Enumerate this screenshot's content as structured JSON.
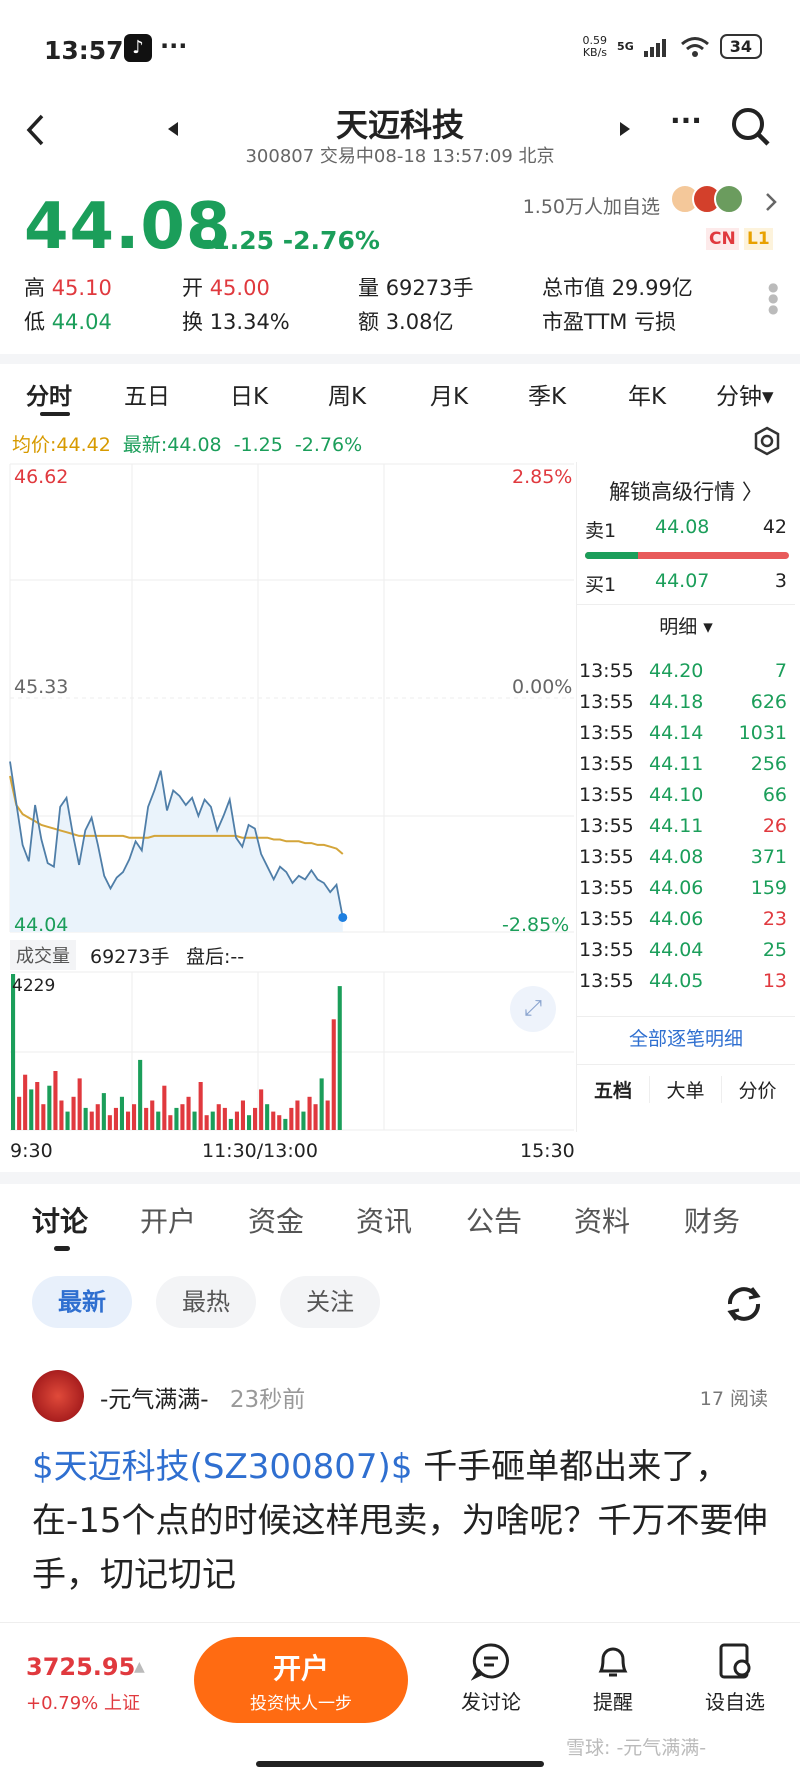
{
  "status_bar": {
    "time": "13:57",
    "net_speed": "0.59 KB/s",
    "network": "5G",
    "battery": "34"
  },
  "header": {
    "title": "天迈科技",
    "subtitle": "300807 交易中08-18 13:57:09 北京",
    "followers": "1.50万人加自选",
    "badges": [
      "CN",
      "L1"
    ]
  },
  "quote": {
    "price": "44.08",
    "change": "-1.25",
    "change_pct": "-2.76%",
    "stats": [
      {
        "label": "高",
        "value": "45.10",
        "color": "#e0393e"
      },
      {
        "label": "开",
        "value": "45.00",
        "color": "#e0393e"
      },
      {
        "label": "量",
        "value": "69273手",
        "color": "#222"
      },
      {
        "label": "总市值",
        "value": "29.99亿",
        "color": "#222"
      },
      {
        "label": "低",
        "value": "44.04",
        "color": "#1b9e5a"
      },
      {
        "label": "换",
        "value": "13.34%",
        "color": "#222"
      },
      {
        "label": "额",
        "value": "3.08亿",
        "color": "#222"
      },
      {
        "label": "市盈TTM",
        "value": "亏损",
        "color": "#222"
      }
    ]
  },
  "ktabs": [
    "分时",
    "五日",
    "日K",
    "周K",
    "月K",
    "季K",
    "年K",
    "分钟▾"
  ],
  "legend": {
    "avg": "均价:44.42",
    "latest": "最新:44.08",
    "chg": "-1.25",
    "pct": "-2.76%"
  },
  "chart_axis": {
    "top_price": "46.62",
    "mid_price": "45.33",
    "bottom_price": "44.04",
    "top_pct": "2.85%",
    "mid_pct": "0.00%",
    "bottom_pct": "-2.85%",
    "vol_label": "成交量",
    "vol_value": "69273手",
    "after_hours": "盘后:--",
    "vol_max": "4229",
    "times": [
      "9:30",
      "11:30/13:00",
      "15:30"
    ]
  },
  "chart_data": {
    "type": "line",
    "title": "",
    "ylim": [
      44.04,
      46.62
    ],
    "series": [
      {
        "name": "",
        "values": [
          44.98,
          44.75,
          44.52,
          44.43,
          44.74,
          44.55,
          44.42,
          44.4,
          44.73,
          44.78,
          44.58,
          44.41,
          44.6,
          44.67,
          44.52,
          44.35,
          44.28,
          44.34,
          44.37,
          44.44,
          44.54,
          44.49,
          44.73,
          44.82,
          44.93,
          44.71,
          44.82,
          44.79,
          44.74,
          44.78,
          44.68,
          44.77,
          44.73,
          44.6,
          44.68,
          44.77,
          44.56,
          44.51,
          44.63,
          44.61,
          44.47,
          44.4,
          44.33,
          44.4,
          44.37,
          44.31,
          44.35,
          44.33,
          44.38,
          44.33,
          44.31,
          44.26,
          44.3,
          44.12
        ]
      },
      {
        "name": "",
        "values": [
          44.9,
          44.74,
          44.69,
          44.67,
          44.65,
          44.63,
          44.62,
          44.61,
          44.6,
          44.59,
          44.58,
          44.57,
          44.57,
          44.57,
          44.57,
          44.57,
          44.57,
          44.57,
          44.57,
          44.56,
          44.56,
          44.56,
          44.56,
          44.57,
          44.57,
          44.57,
          44.57,
          44.57,
          44.57,
          44.57,
          44.57,
          44.57,
          44.57,
          44.57,
          44.57,
          44.57,
          44.57,
          44.56,
          44.56,
          44.56,
          44.56,
          44.56,
          44.55,
          44.55,
          44.54,
          44.54,
          44.54,
          44.53,
          44.53,
          44.52,
          44.52,
          44.51,
          44.5,
          44.47
        ]
      }
    ],
    "volume": [
      4229,
      900,
      1500,
      1100,
      1300,
      700,
      1200,
      1600,
      800,
      500,
      900,
      1400,
      600,
      500,
      700,
      1000,
      400,
      600,
      900,
      500,
      700,
      1900,
      600,
      800,
      500,
      1200,
      400,
      600,
      700,
      900,
      500,
      1300,
      400,
      500,
      700,
      600,
      300,
      500,
      800,
      400,
      600,
      1100,
      700,
      500,
      400,
      300,
      600,
      800,
      500,
      900,
      700,
      1400,
      800,
      3000,
      3900
    ]
  },
  "order_book": {
    "unlock": "解锁高级行情 〉",
    "sell": {
      "label": "卖1",
      "price": "44.08",
      "qty": "42"
    },
    "buy": {
      "label": "买1",
      "price": "44.07",
      "qty": "3"
    },
    "detail_label": "明细 ▾",
    "trades": [
      {
        "time": "13:55",
        "price": "44.20",
        "qty": "7"
      },
      {
        "time": "13:55",
        "price": "44.18",
        "qty": "626"
      },
      {
        "time": "13:55",
        "price": "44.14",
        "qty": "1031"
      },
      {
        "time": "13:55",
        "price": "44.11",
        "qty": "256"
      },
      {
        "time": "13:55",
        "price": "44.10",
        "qty": "66"
      },
      {
        "time": "13:55",
        "price": "44.11",
        "qty": "26",
        "qty_color": "#e0393e"
      },
      {
        "time": "13:55",
        "price": "44.08",
        "qty": "371"
      },
      {
        "time": "13:55",
        "price": "44.06",
        "qty": "159"
      },
      {
        "time": "13:55",
        "price": "44.06",
        "qty": "23",
        "qty_color": "#e0393e"
      },
      {
        "time": "13:55",
        "price": "44.04",
        "qty": "25"
      },
      {
        "time": "13:55",
        "price": "44.05",
        "qty": "13",
        "qty_color": "#e0393e"
      }
    ],
    "all_details": "全部逐笔明细",
    "sub_tabs": [
      "五档",
      "大单",
      "分价"
    ]
  },
  "discussion": {
    "tabs": [
      "讨论",
      "开户",
      "资金",
      "资讯",
      "公告",
      "资料",
      "财务"
    ],
    "filters": [
      "最新",
      "最热",
      "关注"
    ],
    "post": {
      "user": "-元气满满-",
      "time": "23秒前",
      "reads": "17 阅读",
      "tag": "$天迈科技(SZ300807)$",
      "text": " 千手砸单都出来了，在-15个点的时候这样甩卖，为啥呢？千万不要伸手，切记切记"
    }
  },
  "bottom_bar": {
    "index_value": "3725.95",
    "index_change": "+0.79% 上证",
    "open_main": "开户",
    "open_sub": "投资快人一步",
    "discuss": "发讨论",
    "remind": "提醒",
    "watch": "设自选",
    "watermark": "雪球: -元气满满-"
  }
}
